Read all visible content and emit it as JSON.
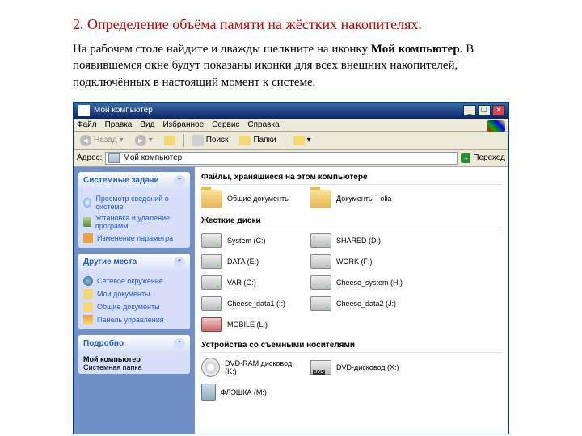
{
  "heading": "2. Определение объёма памяти на жёстких накопителях.",
  "desc_pre": "На рабочем столе найдите и дважды щелкните на иконку ",
  "desc_bold": "Мой компьютер",
  "desc_post": ". В появившемся окне будут показаны иконки для всех внешних накопителей, подключённых в настоящий момент к системе.",
  "window": {
    "title": "Мой компьютер",
    "menu": [
      "Файл",
      "Правка",
      "Вид",
      "Избранное",
      "Сервис",
      "Справка"
    ],
    "toolbar": {
      "back": "Назад",
      "search": "Поиск",
      "folders": "Папки"
    },
    "addr_label": "Адрес:",
    "addr_value": "Мой компьютер",
    "go": "Переход"
  },
  "sidebar": {
    "panels": [
      {
        "title": "Системные задачи",
        "items": [
          {
            "label": "Просмотр сведений о системе",
            "ic": "ic-info"
          },
          {
            "label": "Установка и удаление программ",
            "ic": "ic-inst"
          },
          {
            "label": "Изменение параметра",
            "ic": "ic-edit"
          }
        ]
      },
      {
        "title": "Другие места",
        "items": [
          {
            "label": "Сетевое окружение",
            "ic": "ic-net"
          },
          {
            "label": "Мои документы",
            "ic": "ic-doc"
          },
          {
            "label": "Общие документы",
            "ic": "ic-shared"
          },
          {
            "label": "Панель управления",
            "ic": "ic-panel"
          }
        ]
      },
      {
        "title": "Подробно",
        "foot_title": "Мой компьютер",
        "foot_sub": "Системная папка"
      }
    ]
  },
  "sections": [
    {
      "title": "Файлы, хранящиеся на этом компьютере",
      "items": [
        {
          "label": "Общие документы",
          "type": "folder"
        },
        {
          "label": "Документы - olia",
          "type": "folder"
        }
      ]
    },
    {
      "title": "Жесткие диски",
      "items": [
        {
          "label": "System (C:)",
          "type": "drive"
        },
        {
          "label": "SHARED (D:)",
          "type": "drive"
        },
        {
          "label": "DATA (E:)",
          "type": "drive"
        },
        {
          "label": "WORK (F:)",
          "type": "drive"
        },
        {
          "label": "VAR (G:)",
          "type": "drive"
        },
        {
          "label": "Cheese_system (H:)",
          "type": "drive"
        },
        {
          "label": "Cheese_data1 (I:)",
          "type": "drive"
        },
        {
          "label": "Cheese_data2 (J:)",
          "type": "drive"
        },
        {
          "label": "MOBILE (L:)",
          "type": "usb"
        }
      ]
    },
    {
      "title": "Устройства со съемными носителями",
      "items": [
        {
          "label": "DVD-RAM дисковод (K:)",
          "type": "dvd"
        },
        {
          "label": "DVD-дисковод (X:)",
          "type": "dvd2"
        },
        {
          "label": "ФЛЭШКА (M:)",
          "type": "flash"
        }
      ]
    }
  ]
}
